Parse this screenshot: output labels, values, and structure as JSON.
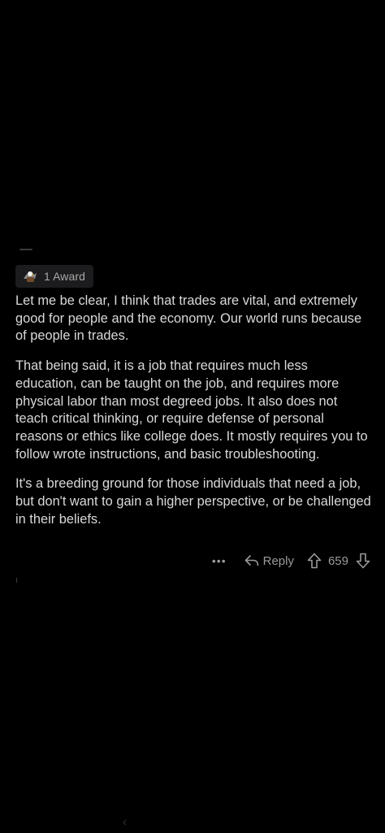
{
  "award": {
    "icon": "award-eagle-icon",
    "label": "1 Award"
  },
  "comment": {
    "paragraphs": [
      "Let me be clear, I think that trades are vital, and extremely good for people and the economy. Our world runs because of people in trades.",
      "That being said, it is a job that requires much less education, can be taught on the job, and requires more physical labor than most degreed jobs. It also does not teach critical thinking, or require defense of personal reasons or ethics like college does. It mostly requires you to follow wrote instructions, and basic troubleshooting.",
      "It's a breeding ground for those individuals that need a job, but don't want to gain a higher perspective,  or be challenged in their beliefs."
    ]
  },
  "actions": {
    "more_label": "•••",
    "reply_label": "Reply",
    "vote_count": "659"
  },
  "colors": {
    "background": "#000000",
    "text": "#d9d9d9",
    "muted": "#9a9a9a",
    "badge_bg": "#1c1c1e"
  }
}
